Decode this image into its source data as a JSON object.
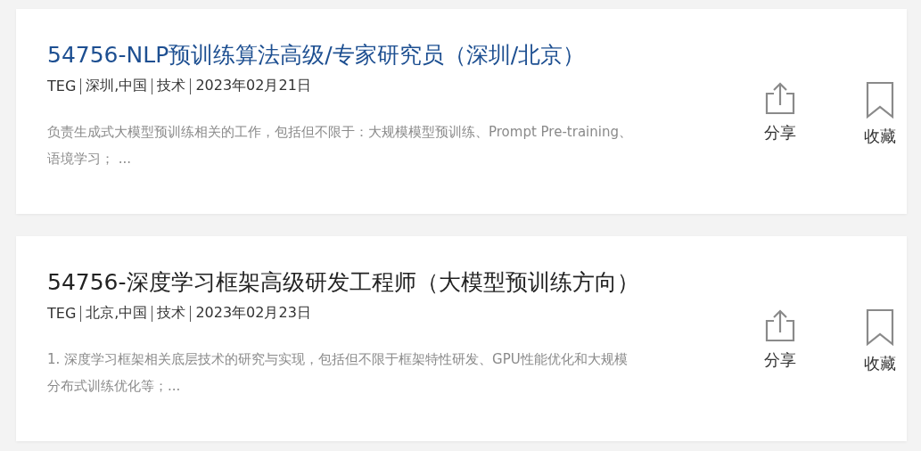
{
  "jobs": [
    {
      "title": "54756-NLP预训练算法高级/专家研究员（深圳/北京）",
      "selected": true,
      "meta": [
        "TEG",
        "深圳,中国",
        "技术",
        "2023年02月21日"
      ],
      "description": "负责生成式大模型预训练相关的工作，包括但不限于：大规模模型预训练、Prompt Pre-training、语境学习； ...",
      "share_label": "分享",
      "favorite_label": "收藏"
    },
    {
      "title": "54756-深度学习框架高级研发工程师（大模型预训练方向）",
      "selected": false,
      "meta": [
        "TEG",
        "北京,中国",
        "技术",
        "2023年02月23日"
      ],
      "description": "1. 深度学习框架相关底层技术的研究与实现，包括但不限于框架特性研发、GPU性能优化和大规模分布式训练优化等；...",
      "share_label": "分享",
      "favorite_label": "收藏"
    }
  ]
}
